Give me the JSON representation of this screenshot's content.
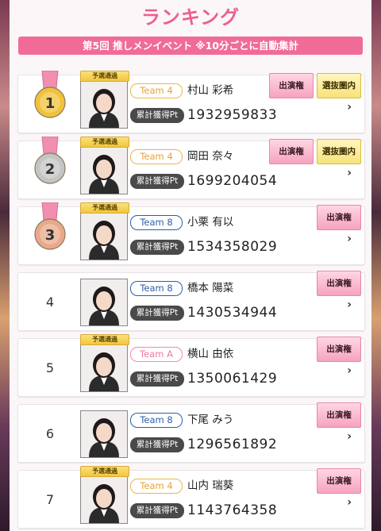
{
  "page": {
    "title": "ランキング",
    "banner": "第5回 推しメンイベント ※10分ごとに自動集計"
  },
  "labels": {
    "qualifier": "予選通過",
    "points": "累計獲得Pt",
    "appearance": "出演権",
    "selection": "選抜圏内"
  },
  "ranking": [
    {
      "rank": "1",
      "medal": "gold",
      "team": "Team 4",
      "team_style": "gold",
      "name": "村山 彩希",
      "points": "1932959833",
      "qualifier": true,
      "selection": true
    },
    {
      "rank": "2",
      "medal": "silver",
      "team": "Team 4",
      "team_style": "gold",
      "name": "岡田 奈々",
      "points": "1699204054",
      "qualifier": true,
      "selection": true
    },
    {
      "rank": "3",
      "medal": "bronze",
      "team": "Team 8",
      "team_style": "blue",
      "name": "小栗 有以",
      "points": "1534358029",
      "qualifier": true,
      "selection": false
    },
    {
      "rank": "4",
      "medal": "",
      "team": "Team 8",
      "team_style": "blue",
      "name": "橋本 陽菜",
      "points": "1430534944",
      "qualifier": false,
      "selection": false
    },
    {
      "rank": "5",
      "medal": "",
      "team": "Team A",
      "team_style": "pink",
      "name": "横山 由依",
      "points": "1350061429",
      "qualifier": true,
      "selection": false
    },
    {
      "rank": "6",
      "medal": "",
      "team": "Team 8",
      "team_style": "blue",
      "name": "下尾 みう",
      "points": "1296561892",
      "qualifier": false,
      "selection": false
    },
    {
      "rank": "7",
      "medal": "",
      "team": "Team 4",
      "team_style": "gold",
      "name": "山内 瑞葵",
      "points": "1143764358",
      "qualifier": true,
      "selection": false
    }
  ],
  "colors": {
    "accent": "#ee5f91",
    "gold": "#f0c23a",
    "silver": "#c4c4c4",
    "bronze": "#e8a98a"
  }
}
